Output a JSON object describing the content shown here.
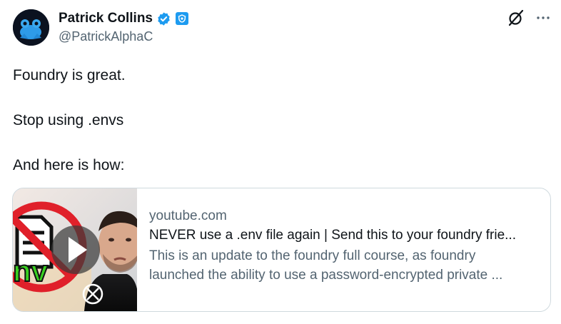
{
  "author": {
    "name": "Patrick Collins",
    "handle": "@PatrickAlphaC"
  },
  "icons": {
    "avatar": "blue-frog-avatar",
    "verified": "verified-badge-icon",
    "affiliate": "affiliate-badge-icon",
    "grok": "grok-icon",
    "more": "more-icon",
    "play": "play-icon"
  },
  "tweet": {
    "lines": [
      "Foundry is great.",
      "Stop using .envs",
      "And here is how:"
    ]
  },
  "card": {
    "domain": "youtube.com",
    "title": "NEVER use a .env file again | Send this to your foundry frie...",
    "description_line1": "This is an update to the foundry full course, as foundry",
    "description_line2": "launched the ability to use a password-encrypted private ...",
    "thumb_text": "nv"
  },
  "colors": {
    "verified": "#1d9bf0",
    "secondary_text": "#536471",
    "border": "#cfd9de",
    "no_sign_red": "#e0202a",
    "env_green": "#39d020"
  }
}
